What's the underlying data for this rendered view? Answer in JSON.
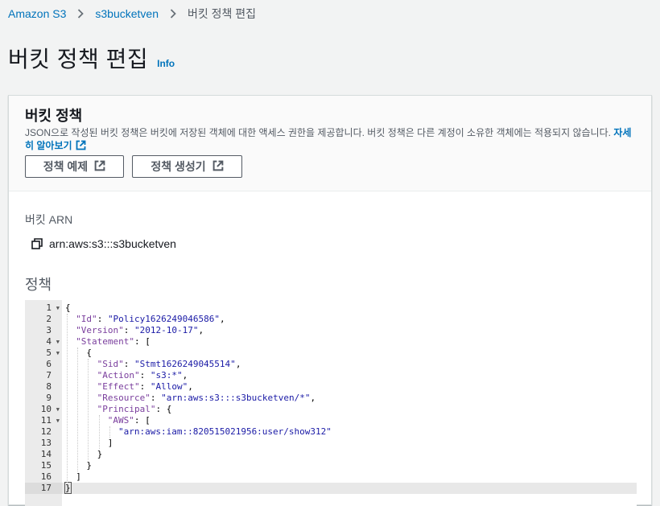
{
  "breadcrumb": {
    "items": [
      "Amazon S3",
      "s3bucketven"
    ],
    "current": "버킷 정책 편집"
  },
  "header": {
    "title": "버킷 정책 편집",
    "info": "Info"
  },
  "panel": {
    "title": "버킷 정책",
    "description": "JSON으로 작성된 버킷 정책은 버킷에 저장된 객체에 대한 액세스 권한을 제공합니다. 버킷 정책은 다른 계정이 소유한 객체에는 적용되지 않습니다.",
    "learn_more": "자세히 알아보기",
    "buttons": {
      "examples": "정책 예제",
      "generator": "정책 생성기"
    }
  },
  "arn": {
    "label": "버킷 ARN",
    "value": "arn:aws:s3:::s3bucketven"
  },
  "policy": {
    "label": "정책",
    "active_line": 17,
    "lines": [
      {
        "n": "1",
        "fold": true,
        "indent": 0,
        "tokens": [
          [
            "p",
            "{"
          ]
        ]
      },
      {
        "n": "2",
        "fold": false,
        "indent": 1,
        "tokens": [
          [
            "k",
            "\"Id\""
          ],
          [
            "p",
            ": "
          ],
          [
            "s",
            "\"Policy1626249046586\""
          ],
          [
            "p",
            ","
          ]
        ]
      },
      {
        "n": "3",
        "fold": false,
        "indent": 1,
        "tokens": [
          [
            "k",
            "\"Version\""
          ],
          [
            "p",
            ": "
          ],
          [
            "s",
            "\"2012-10-17\""
          ],
          [
            "p",
            ","
          ]
        ]
      },
      {
        "n": "4",
        "fold": true,
        "indent": 1,
        "tokens": [
          [
            "k",
            "\"Statement\""
          ],
          [
            "p",
            ": ["
          ]
        ]
      },
      {
        "n": "5",
        "fold": true,
        "indent": 2,
        "tokens": [
          [
            "p",
            "{"
          ]
        ]
      },
      {
        "n": "6",
        "fold": false,
        "indent": 3,
        "tokens": [
          [
            "k",
            "\"Sid\""
          ],
          [
            "p",
            ": "
          ],
          [
            "s",
            "\"Stmt1626249045514\""
          ],
          [
            "p",
            ","
          ]
        ]
      },
      {
        "n": "7",
        "fold": false,
        "indent": 3,
        "tokens": [
          [
            "k",
            "\"Action\""
          ],
          [
            "p",
            ": "
          ],
          [
            "s",
            "\"s3:*\""
          ],
          [
            "p",
            ","
          ]
        ]
      },
      {
        "n": "8",
        "fold": false,
        "indent": 3,
        "tokens": [
          [
            "k",
            "\"Effect\""
          ],
          [
            "p",
            ": "
          ],
          [
            "s",
            "\"Allow\""
          ],
          [
            "p",
            ","
          ]
        ]
      },
      {
        "n": "9",
        "fold": false,
        "indent": 3,
        "tokens": [
          [
            "k",
            "\"Resource\""
          ],
          [
            "p",
            ": "
          ],
          [
            "s",
            "\"arn:aws:s3:::s3bucketven/*\""
          ],
          [
            "p",
            ","
          ]
        ]
      },
      {
        "n": "10",
        "fold": true,
        "indent": 3,
        "tokens": [
          [
            "k",
            "\"Principal\""
          ],
          [
            "p",
            ": {"
          ]
        ]
      },
      {
        "n": "11",
        "fold": true,
        "indent": 4,
        "tokens": [
          [
            "k",
            "\"AWS\""
          ],
          [
            "p",
            ": ["
          ]
        ]
      },
      {
        "n": "12",
        "fold": false,
        "indent": 5,
        "tokens": [
          [
            "s",
            "\"arn:aws:iam::820515021956:user/show312\""
          ]
        ]
      },
      {
        "n": "13",
        "fold": false,
        "indent": 4,
        "tokens": [
          [
            "p",
            "]"
          ]
        ]
      },
      {
        "n": "14",
        "fold": false,
        "indent": 3,
        "tokens": [
          [
            "p",
            "}"
          ]
        ]
      },
      {
        "n": "15",
        "fold": false,
        "indent": 2,
        "tokens": [
          [
            "p",
            "}"
          ]
        ]
      },
      {
        "n": "16",
        "fold": false,
        "indent": 1,
        "tokens": [
          [
            "p",
            "]"
          ]
        ]
      },
      {
        "n": "17",
        "fold": false,
        "indent": 0,
        "tokens": [
          [
            "p",
            "}"
          ]
        ]
      }
    ]
  },
  "colors": {
    "link": "#0073bb",
    "keyword": "#7a3e9d",
    "string": "#1a1aa6",
    "gutter": "#ebebeb"
  },
  "icons": {
    "breadcrumb_separator": "chevron-right-icon",
    "external": "external-link-icon",
    "copy": "copy-icon",
    "fold": "fold-arrow-icon"
  }
}
